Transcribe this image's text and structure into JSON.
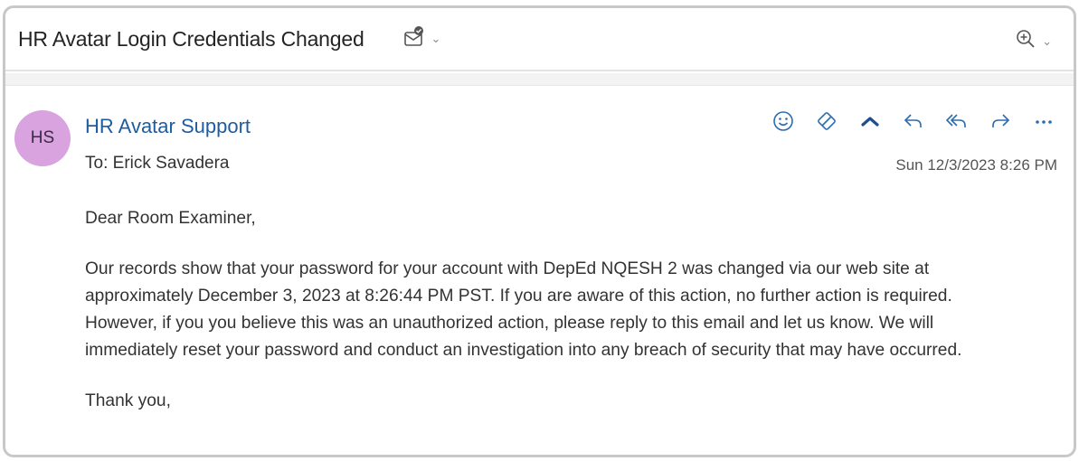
{
  "subject": "HR Avatar Login Credentials Changed",
  "header_icons": {
    "tag": "envelope-check-icon",
    "tag_menu": "chevron-down-icon",
    "zoom": "zoom-in-icon",
    "zoom_menu": "chevron-down-icon"
  },
  "sender": {
    "initials": "HS",
    "name": "HR Avatar Support",
    "to_label": "To:",
    "to_name": "Erick Savadera",
    "date": "Sun 12/3/2023 8:26 PM",
    "avatar_color": "#d9a3e0"
  },
  "actions": [
    {
      "name": "emoji-icon"
    },
    {
      "name": "immersive-reader-icon"
    },
    {
      "name": "collapse-icon"
    },
    {
      "name": "reply-icon"
    },
    {
      "name": "reply-all-icon"
    },
    {
      "name": "forward-icon"
    },
    {
      "name": "more-icon"
    }
  ],
  "body": {
    "greeting": "Dear Room Examiner,",
    "lines": [
      "Our records show that your password for your account with DepEd NQESH 2 was changed via our web site at",
      "approximately December 3, 2023 at 8:26:44 PM PST. If you are aware of this action, no further action is required.",
      "However, if you you believe this was an unauthorized action, please reply to this email and let us know. We will",
      "immediately reset your password and conduct an investigation into any breach of security that may have occurred."
    ],
    "closing": "Thank you,"
  },
  "colors": {
    "accent": "#1f5c9e",
    "icon": "#2b6cb0"
  }
}
